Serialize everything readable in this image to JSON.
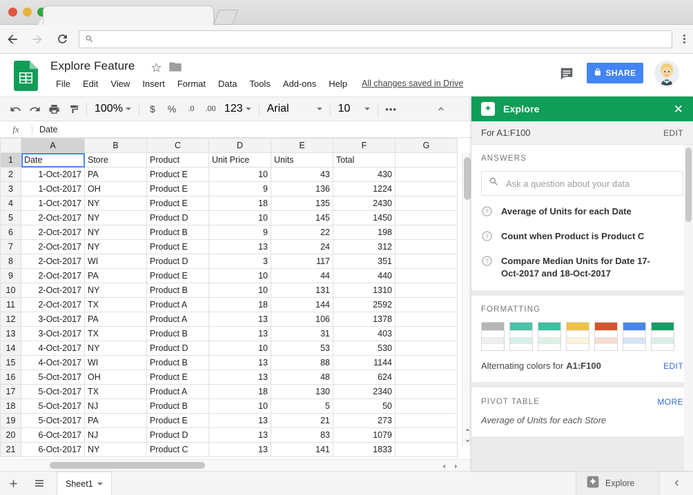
{
  "browser": {
    "omnibox_value": "",
    "omnibox_placeholder": "",
    "back_icon": "back-arrow-icon",
    "forward_icon": "forward-arrow-icon",
    "reload_icon": "reload-icon",
    "search_icon": "search-icon"
  },
  "header": {
    "doc_title": "Explore Feature",
    "star_icon": "star-icon",
    "folder_icon": "folder-icon",
    "save_status": "All changes saved in Drive",
    "share_label": "SHARE",
    "lock_icon": "lock-icon",
    "comment_icon": "comment-icon",
    "menus": [
      "File",
      "Edit",
      "View",
      "Insert",
      "Format",
      "Data",
      "Tools",
      "Add-ons",
      "Help"
    ]
  },
  "toolbar": {
    "undo_icon": "undo-icon",
    "redo_icon": "redo-icon",
    "print_icon": "print-icon",
    "paint_format_icon": "paint-format-icon",
    "zoom_value": "100%",
    "currency_label": "$",
    "percent_label": "%",
    "decrease_decimal_label": ".0",
    "increase_decimal_label": ".00",
    "more_formats_label": "123",
    "font_family_value": "Arial",
    "font_size_value": "10",
    "more_label": "•••",
    "collapse_icon": "chevron-up-icon"
  },
  "formula_bar": {
    "fx_label": "fx",
    "value": "Date"
  },
  "grid": {
    "columns": [
      "A",
      "B",
      "C",
      "D",
      "E",
      "F",
      "G"
    ],
    "selected_column": "A",
    "selected_row": "1",
    "selected_cell": "A1",
    "headers": [
      "Date",
      "Store",
      "Product",
      "Unit Price",
      "Units",
      "Total"
    ],
    "rows": [
      {
        "n": "1",
        "cells": [
          "Date",
          "Store",
          "Product",
          "Unit Price",
          "Units",
          "Total",
          ""
        ]
      },
      {
        "n": "2",
        "cells": [
          "1-Oct-2017",
          "PA",
          "Product E",
          "10",
          "43",
          "430",
          ""
        ]
      },
      {
        "n": "3",
        "cells": [
          "1-Oct-2017",
          "OH",
          "Product E",
          "9",
          "136",
          "1224",
          ""
        ]
      },
      {
        "n": "4",
        "cells": [
          "1-Oct-2017",
          "NY",
          "Product E",
          "18",
          "135",
          "2430",
          ""
        ]
      },
      {
        "n": "5",
        "cells": [
          "2-Oct-2017",
          "NY",
          "Product D",
          "10",
          "145",
          "1450",
          ""
        ]
      },
      {
        "n": "6",
        "cells": [
          "2-Oct-2017",
          "NY",
          "Product B",
          "9",
          "22",
          "198",
          ""
        ]
      },
      {
        "n": "7",
        "cells": [
          "2-Oct-2017",
          "NY",
          "Product E",
          "13",
          "24",
          "312",
          ""
        ]
      },
      {
        "n": "8",
        "cells": [
          "2-Oct-2017",
          "WI",
          "Product D",
          "3",
          "117",
          "351",
          ""
        ]
      },
      {
        "n": "9",
        "cells": [
          "2-Oct-2017",
          "PA",
          "Product E",
          "10",
          "44",
          "440",
          ""
        ]
      },
      {
        "n": "10",
        "cells": [
          "2-Oct-2017",
          "NY",
          "Product B",
          "10",
          "131",
          "1310",
          ""
        ]
      },
      {
        "n": "11",
        "cells": [
          "2-Oct-2017",
          "TX",
          "Product A",
          "18",
          "144",
          "2592",
          ""
        ]
      },
      {
        "n": "12",
        "cells": [
          "3-Oct-2017",
          "PA",
          "Product A",
          "13",
          "106",
          "1378",
          ""
        ]
      },
      {
        "n": "13",
        "cells": [
          "3-Oct-2017",
          "TX",
          "Product B",
          "13",
          "31",
          "403",
          ""
        ]
      },
      {
        "n": "14",
        "cells": [
          "4-Oct-2017",
          "NY",
          "Product D",
          "10",
          "53",
          "530",
          ""
        ]
      },
      {
        "n": "15",
        "cells": [
          "4-Oct-2017",
          "WI",
          "Product B",
          "13",
          "88",
          "1144",
          ""
        ]
      },
      {
        "n": "16",
        "cells": [
          "5-Oct-2017",
          "OH",
          "Product E",
          "13",
          "48",
          "624",
          ""
        ]
      },
      {
        "n": "17",
        "cells": [
          "5-Oct-2017",
          "TX",
          "Product A",
          "18",
          "130",
          "2340",
          ""
        ]
      },
      {
        "n": "18",
        "cells": [
          "5-Oct-2017",
          "NJ",
          "Product B",
          "10",
          "5",
          "50",
          ""
        ]
      },
      {
        "n": "19",
        "cells": [
          "5-Oct-2017",
          "PA",
          "Product E",
          "13",
          "21",
          "273",
          ""
        ]
      },
      {
        "n": "20",
        "cells": [
          "6-Oct-2017",
          "NJ",
          "Product D",
          "13",
          "83",
          "1079",
          ""
        ]
      },
      {
        "n": "21",
        "cells": [
          "6-Oct-2017",
          "NY",
          "Product C",
          "13",
          "141",
          "1833",
          ""
        ]
      }
    ]
  },
  "bottom_bar": {
    "add_sheet_icon": "plus-icon",
    "all_sheets_icon": "list-icon",
    "sheet_tab_label": "Sheet1",
    "sheet_tab_caret_icon": "chevron-down-icon",
    "explore_label": "Explore",
    "explore_icon": "explore-star-icon",
    "collapse_icon": "chevron-left-icon"
  },
  "explore": {
    "title": "Explore",
    "icon": "explore-star-icon",
    "close_icon": "close-icon",
    "range_label": "For A1:F100",
    "range_edit_label": "EDIT",
    "answers": {
      "section_title": "ANSWERS",
      "search_placeholder": "Ask a question about your data",
      "search_value": "",
      "search_icon": "search-icon",
      "questions": [
        "Average of Units for each Date",
        "Count when Product is Product C",
        "Compare Median Units for Date 17-Oct-2017 and 18-Oct-2017"
      ],
      "question_icon": "question-mark-circle-icon"
    },
    "formatting": {
      "section_title": "FORMATTING",
      "footer_prefix": "Alternating colors for",
      "footer_range": "A1:F100",
      "edit_label": "EDIT",
      "swatches": [
        {
          "name": "grey",
          "header": "#b7b7b7",
          "band": "#efefef"
        },
        {
          "name": "teal",
          "header": "#4dc0a8",
          "band": "#d5f0ea"
        },
        {
          "name": "green",
          "header": "#3dbfa0",
          "band": "#ddf0e6"
        },
        {
          "name": "yellow",
          "header": "#eec14a",
          "band": "#fbf3d7"
        },
        {
          "name": "orange",
          "header": "#d2552f",
          "band": "#f8ddd0"
        },
        {
          "name": "blue",
          "header": "#4a86e8",
          "band": "#d8e4f6"
        },
        {
          "name": "dark-green",
          "header": "#189d63",
          "band": "#daeee7"
        }
      ]
    },
    "pivot_table": {
      "section_title": "PIVOT TABLE",
      "more_label": "MORE",
      "suggestion": "Average of Units for each Store"
    }
  },
  "colors": {
    "sheets_green": "#0f9d58",
    "share_blue": "#4285f4",
    "link_blue": "#3367d6",
    "selection_blue": "#4285f4"
  }
}
